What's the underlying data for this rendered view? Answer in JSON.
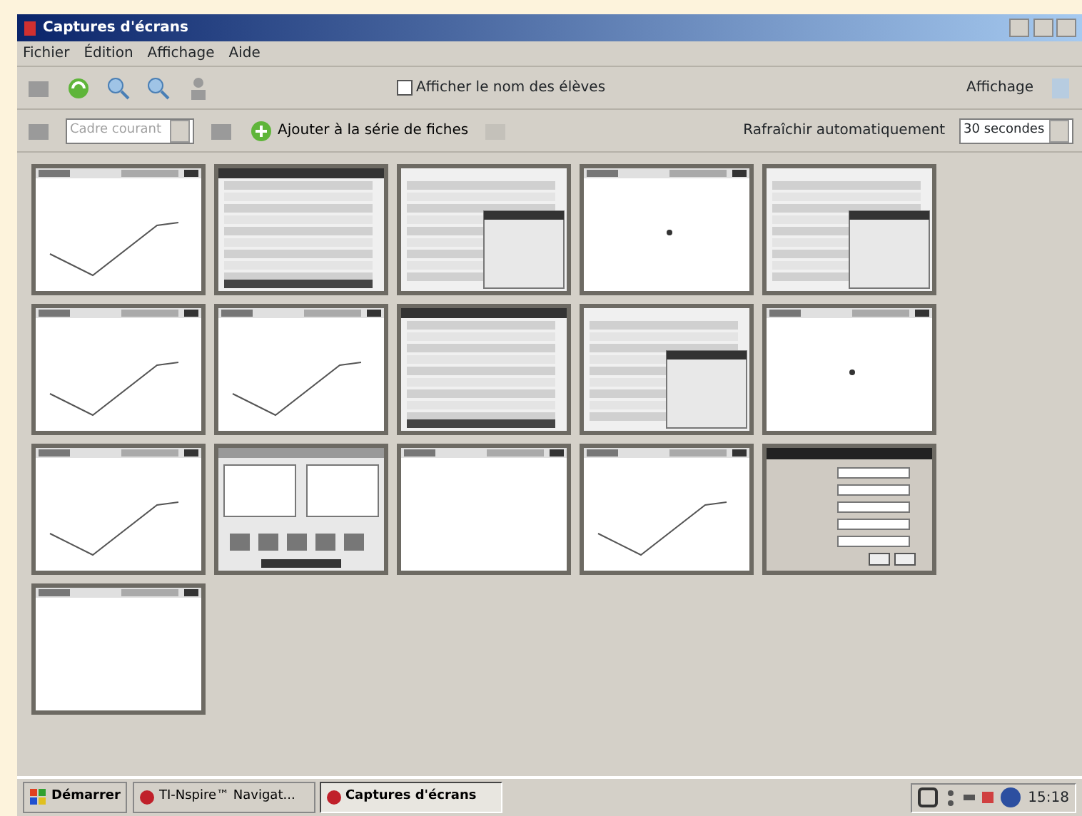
{
  "window": {
    "title": "Captures d'écrans"
  },
  "menu": [
    "Fichier",
    "Édition",
    "Affichage",
    "Aide"
  ],
  "toolbar": {
    "show_names": {
      "label": "Afficher le nom des élèves",
      "checked": false
    },
    "view_label": "Affichage"
  },
  "toolbar2": {
    "frame_select": {
      "value": "Cadre courant",
      "disabled": true
    },
    "add_button": "Ajouter à la série de fiches",
    "refresh_label": "Rafraîchir automatiquement",
    "refresh_value": "30 secondes"
  },
  "thumbnails": [
    {
      "kind": "graph"
    },
    {
      "kind": "menu"
    },
    {
      "kind": "submenu"
    },
    {
      "kind": "point"
    },
    {
      "kind": "submenu"
    },
    {
      "kind": "graph"
    },
    {
      "kind": "graph"
    },
    {
      "kind": "menu"
    },
    {
      "kind": "submenu"
    },
    {
      "kind": "point"
    },
    {
      "kind": "graph"
    },
    {
      "kind": "panel"
    },
    {
      "kind": "blank"
    },
    {
      "kind": "graph"
    },
    {
      "kind": "dialog"
    },
    {
      "kind": "blank"
    }
  ],
  "taskbar": {
    "start": "Démarrer",
    "tasks": [
      {
        "label": "TI-Nspire™ Navigat...",
        "selected": false
      },
      {
        "label": "Captures d'écrans",
        "selected": true
      }
    ],
    "clock": "15:18"
  }
}
